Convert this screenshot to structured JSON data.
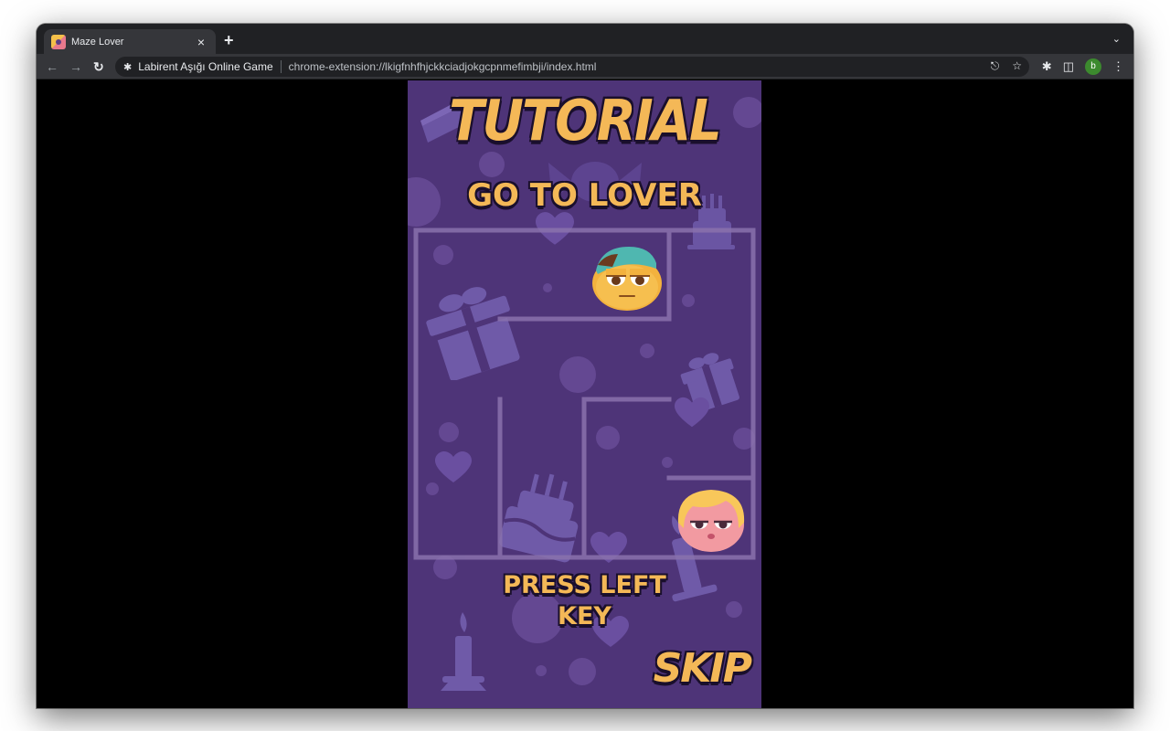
{
  "browser": {
    "tab_title": "Maze Lover",
    "tab_close": "×",
    "new_tab": "+",
    "site_name": "Labirent Aşığı Online Game",
    "url": "chrome-extension://lkigfnhfhjckkciadjokgcpnmefimbji/index.html",
    "profile_initial": "b",
    "icons": [
      "back-arrow-icon",
      "forward-arrow-icon",
      "reload-icon",
      "puzzle-icon",
      "share-icon",
      "star-icon",
      "side-panel-icon",
      "menu-icon"
    ]
  },
  "game": {
    "title": "TUTORIAL",
    "subtitle": "GO TO LOVER",
    "instruction_line1": "PRESS LEFT",
    "instruction_line2": "KEY",
    "skip_label": "SKIP",
    "colors": {
      "background": "#4e3478",
      "title_fill": "#f4b857",
      "outline": "#1a0f2c",
      "maze_wall": "#8a72ad"
    },
    "characters": [
      "boy-character",
      "girl-character"
    ]
  }
}
